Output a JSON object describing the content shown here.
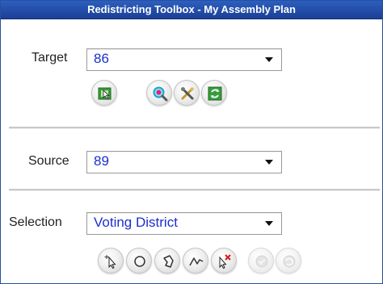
{
  "window": {
    "title": "Redistricting Toolbox - My Assembly Plan"
  },
  "target": {
    "label": "Target",
    "value": "86"
  },
  "source": {
    "label": "Source",
    "value": "89"
  },
  "selection": {
    "label": "Selection",
    "value": "Voting District"
  },
  "icons": {
    "target_tools": [
      "select-district-icon",
      "zoom-to-district-icon",
      "tools-icon",
      "refresh-district-icon"
    ],
    "selection_tools": [
      "point-select-icon",
      "circle-select-icon",
      "lasso-select-icon",
      "line-select-icon",
      "clear-selection-icon",
      "accept-icon",
      "undo-icon"
    ]
  },
  "colors": {
    "title_bar": "#1f4aa3",
    "dropdown_text": "#1a2fd0",
    "green_icon": "#3a9b3a",
    "magnifier": "#1aa6c8"
  }
}
